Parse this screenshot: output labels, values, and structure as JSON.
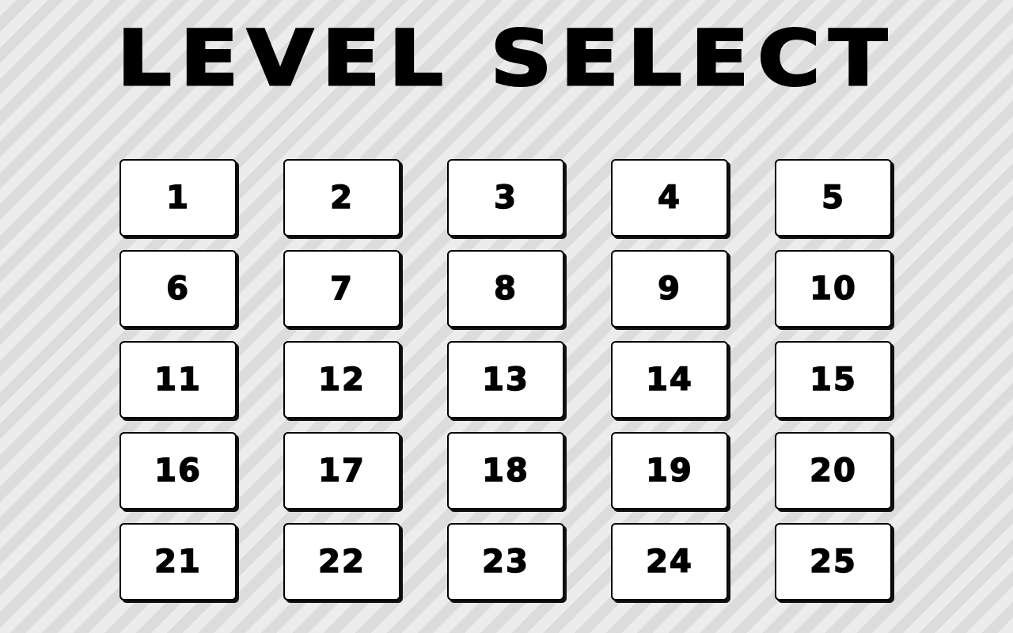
{
  "title": "LEVEL SELECT",
  "levels": [
    "1",
    "2",
    "3",
    "4",
    "5",
    "6",
    "7",
    "8",
    "9",
    "10",
    "11",
    "12",
    "13",
    "14",
    "15",
    "16",
    "17",
    "18",
    "19",
    "20",
    "21",
    "22",
    "23",
    "24",
    "25"
  ],
  "colors": {
    "background_light": "#ececec",
    "background_stripe": "#dcdcdc",
    "button_fill": "#ffffff",
    "outline": "#000000"
  }
}
